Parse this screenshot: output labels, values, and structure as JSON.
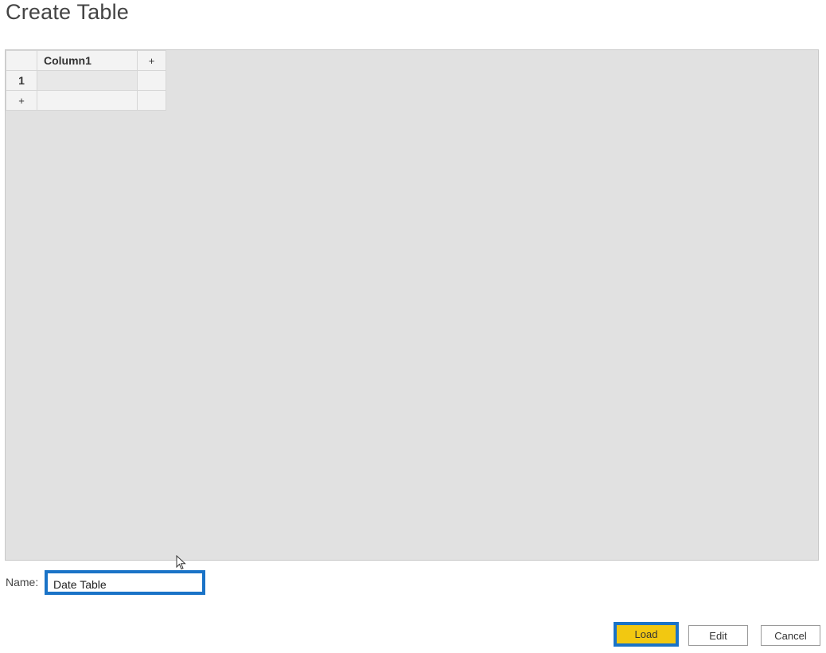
{
  "dialog": {
    "title": "Create Table"
  },
  "grid": {
    "column_headers": [
      "Column1"
    ],
    "add_column_symbol": "+",
    "rows": [
      {
        "number": "1",
        "values": [
          ""
        ]
      }
    ],
    "add_row_symbol": "+"
  },
  "name_field": {
    "label": "Name:",
    "value": "Date Table"
  },
  "buttons": {
    "load": "Load",
    "edit": "Edit",
    "cancel": "Cancel"
  },
  "colors": {
    "accent_border": "#1a73c7",
    "load_button": "#f2c811",
    "grid_background": "#e1e1e1"
  }
}
